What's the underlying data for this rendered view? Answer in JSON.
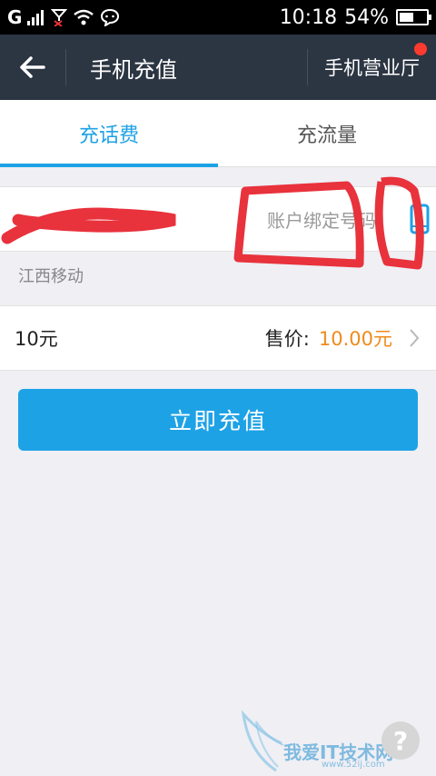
{
  "status_bar": {
    "network": "G",
    "time": "10:18",
    "battery": "54%",
    "battery_level": 0.54
  },
  "header": {
    "title": "手机充值",
    "right_link": "手机营业厅",
    "has_notification_dot": true
  },
  "tabs": [
    {
      "label": "充话费",
      "active": true
    },
    {
      "label": "充流量",
      "active": false
    }
  ],
  "phone": {
    "value": "",
    "hint": "账户绑定号码",
    "carrier": "江西移动"
  },
  "amount": {
    "value": "10元",
    "price_label": "售价:",
    "price_value": "10.00元"
  },
  "recharge_button": "立即充值",
  "watermark": {
    "text": "我爱IT技术网",
    "subtext": "www.52ij.com",
    "help": "?"
  },
  "colors": {
    "accent": "#1ea2e6",
    "header_bg": "#2c3542",
    "price": "#f08a1c",
    "notification": "#ff3b30"
  }
}
